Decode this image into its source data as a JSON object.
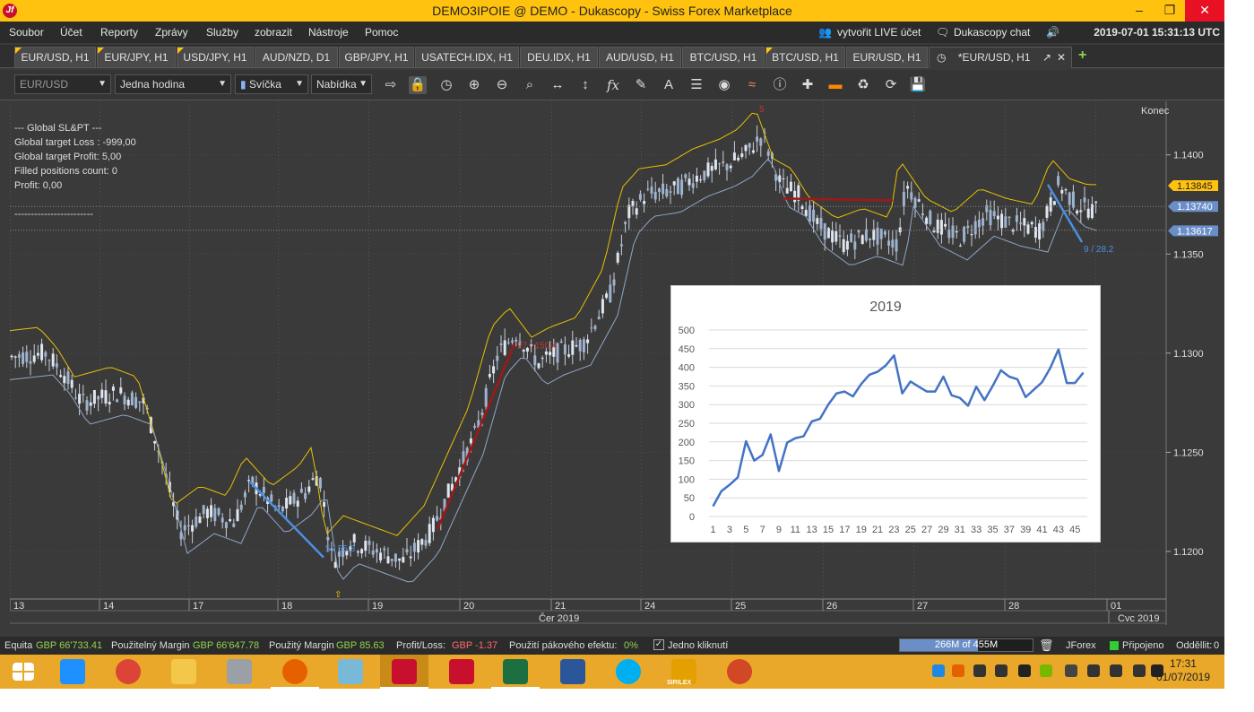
{
  "window": {
    "title": "DEMO3IPOIE @ DEMO - Dukascopy - Swiss Forex Marketplace",
    "app_icon_letter": "Jf",
    "controls": {
      "minimize": "–",
      "maximize": "❐",
      "close": "✕"
    }
  },
  "menu": {
    "items": [
      "Soubor",
      "Účet",
      "Reporty",
      "Zprávy",
      "Služby",
      "zobrazit",
      "Nástroje",
      "Pomoc"
    ],
    "live_account": "vytvořit LIVE účet",
    "chat": "Dukascopy chat",
    "datetime": "2019-07-01 15:31:13 UTC"
  },
  "tabs": [
    {
      "label": "EUR/USD, H1",
      "marker": true
    },
    {
      "label": "EUR/JPY, H1",
      "marker": true
    },
    {
      "label": "USD/JPY, H1",
      "marker": true
    },
    {
      "label": "AUD/NZD, D1",
      "marker": false
    },
    {
      "label": "GBP/JPY, H1",
      "marker": false
    },
    {
      "label": "USATECH.IDX, H1",
      "marker": false
    },
    {
      "label": "DEU.IDX, H1",
      "marker": false
    },
    {
      "label": "AUD/USD, H1",
      "marker": false
    },
    {
      "label": "BTC/USD, H1",
      "marker": false
    },
    {
      "label": "BTC/USD, H1",
      "marker": true
    },
    {
      "label": "EUR/USD, H1",
      "marker": false
    },
    {
      "label": "*EUR/USD, H1",
      "marker": false,
      "active": true
    }
  ],
  "toolbar": {
    "instrument": "EUR/USD",
    "period": "Jedna hodina",
    "chart_type": "Svíčka",
    "offer_side": "Nabídka"
  },
  "strategy_panel": {
    "lines": [
      "--- Global SL&PT ---",
      "Global target Loss  : -999,00",
      "Global target Profit: 5,00",
      "Filled positions count: 0",
      "Profit: 0,00",
      "",
      "------------------------"
    ]
  },
  "price_chart": {
    "corner_label": "Konec",
    "price_ticks": [
      "1.1400",
      "1.1350",
      "1.1300",
      "1.1250",
      "1.1200"
    ],
    "price_badges": [
      {
        "value": "1.13845",
        "color": "#ffc20e",
        "text_color": "#222"
      },
      {
        "value": "1.13740",
        "color": "#6a8fc8",
        "text_color": "#fff"
      },
      {
        "value": "1.13617",
        "color": "#6a8fc8",
        "text_color": "#fff"
      }
    ],
    "date_ticks": [
      "13",
      "14",
      "17",
      "18",
      "19",
      "20",
      "21",
      "24",
      "25",
      "26",
      "27",
      "28",
      "01"
    ],
    "month_labels": [
      "Čer 2019",
      "Cvc 2019"
    ],
    "annotations": [
      {
        "text": "5 / 55.8",
        "color": "#4a90e2"
      },
      {
        "text": "9 / 28.2",
        "color": "#4a90e2"
      },
      {
        "text": "27 / 150.4",
        "color": "#c0392b"
      },
      {
        "text": "5",
        "color": "#c0392b"
      }
    ]
  },
  "chart_data": {
    "type": "line",
    "title": "2019",
    "xlabel": "",
    "ylabel": "",
    "ylim": [
      0,
      500
    ],
    "y_ticks": [
      "0",
      "50",
      "100",
      "150",
      "200",
      "250",
      "300",
      "350",
      "400",
      "450",
      "500"
    ],
    "x_tick_labels": [
      "1",
      "3",
      "5",
      "7",
      "9",
      "11",
      "13",
      "15",
      "17",
      "19",
      "21",
      "23",
      "25",
      "27",
      "29",
      "31",
      "33",
      "35",
      "37",
      "39",
      "41",
      "43",
      "45"
    ],
    "x": [
      1,
      2,
      3,
      4,
      5,
      6,
      7,
      8,
      9,
      10,
      11,
      12,
      13,
      14,
      15,
      16,
      17,
      18,
      19,
      20,
      21,
      22,
      23,
      24,
      25,
      26,
      27,
      28,
      29,
      30,
      31,
      32,
      33,
      34,
      35,
      36,
      37,
      38,
      39,
      40,
      41,
      42,
      43,
      44,
      45,
      46
    ],
    "series": [
      {
        "color": "#4472c4",
        "values": [
          28,
          68,
          85,
          105,
          202,
          150,
          165,
          220,
          122,
          198,
          210,
          215,
          255,
          262,
          300,
          330,
          335,
          322,
          355,
          380,
          388,
          405,
          432,
          330,
          362,
          348,
          335,
          335,
          375,
          325,
          318,
          297,
          348,
          312,
          350,
          392,
          375,
          368,
          320,
          340,
          360,
          398,
          448,
          358,
          358,
          385
        ]
      }
    ]
  },
  "status_bar": {
    "equity_label": "Equita",
    "equity_value": "GBP 66'733.41",
    "used_margin_label": "Použitelný Margin",
    "used_margin_value": "GBP 66'647.78",
    "margin_used_label": "Použitý Margin",
    "margin_used_value": "GBP 85.63",
    "pl_label": "Profit/Loss:",
    "pl_value": "GBP -1.37",
    "leverage_label": "Použití pákového efektu:",
    "leverage_value": "0%",
    "one_click_label": "Jedno kliknutí",
    "memory": "266M of 455M",
    "memory_fraction": 0.585,
    "platform": "JForex",
    "connection": "Připojeno",
    "disconnected_label": "Odděllit:",
    "disconnected_count": "0"
  },
  "taskbar": {
    "apps": [
      {
        "name": "start-icon",
        "color": "#ffffff"
      },
      {
        "name": "ie-icon",
        "color": "#1e90ff"
      },
      {
        "name": "chrome-icon",
        "color": "#db4437"
      },
      {
        "name": "file-explorer-icon",
        "color": "#f3c74a"
      },
      {
        "name": "calculator-icon",
        "color": "#9aa0a6"
      },
      {
        "name": "firefox-icon",
        "color": "#e66000"
      },
      {
        "name": "paint-icon",
        "color": "#7ab8d8"
      },
      {
        "name": "jforex-icon",
        "color": "#c8102e"
      },
      {
        "name": "gear-app-icon",
        "color": "#c8102e"
      },
      {
        "name": "excel-icon",
        "color": "#1d6f42"
      },
      {
        "name": "word-icon",
        "color": "#2b579a"
      },
      {
        "name": "skype-icon",
        "color": "#00aff0"
      },
      {
        "name": "sirilex-icon",
        "color": "#e4a000"
      },
      {
        "name": "powerpoint-icon",
        "color": "#d24726"
      }
    ],
    "sirilex_label": "SIRILEX",
    "time": "17:31",
    "date": "01/07/2019"
  }
}
